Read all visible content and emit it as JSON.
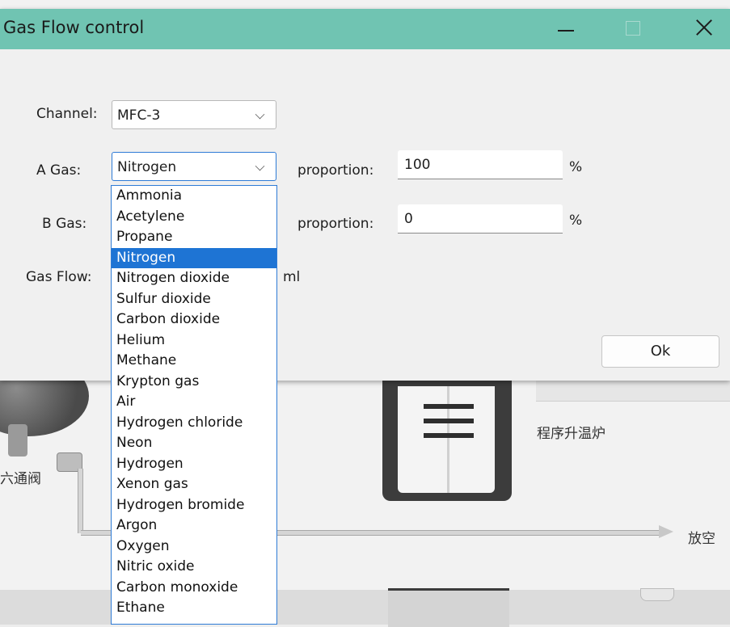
{
  "window": {
    "title": "Gas Flow control",
    "accent_color": "#70c4b2"
  },
  "form": {
    "channel_label": "Channel",
    "channel_value": "MFC-3",
    "a_gas_label": "A Gas",
    "a_gas_value": "Nitrogen",
    "b_gas_label": "B Gas",
    "proportion_label": "proportion",
    "a_proportion_value": "100",
    "b_proportion_value": "0",
    "percent_unit": "%",
    "gas_flow_label": "Gas Flow",
    "gas_flow_unit": "ml",
    "ok_label": "Ok",
    "colon": ":"
  },
  "dropdown": {
    "selected": "Nitrogen",
    "items": [
      "Ammonia",
      "Acetylene",
      "Propane",
      "Nitrogen",
      "Nitrogen dioxide",
      "Sulfur dioxide",
      "Carbon dioxide",
      "Helium",
      "Methane",
      "Krypton gas",
      "Air",
      "Hydrogen chloride",
      "Neon",
      "Hydrogen",
      "Xenon gas",
      "Hydrogen bromide",
      "Argon",
      "Oxygen",
      "Nitric oxide",
      "Carbon monoxide",
      "Ethane"
    ]
  },
  "background": {
    "valve_label": "六通阀",
    "furnace_label": "程序升温炉",
    "vent_label": "放空"
  }
}
